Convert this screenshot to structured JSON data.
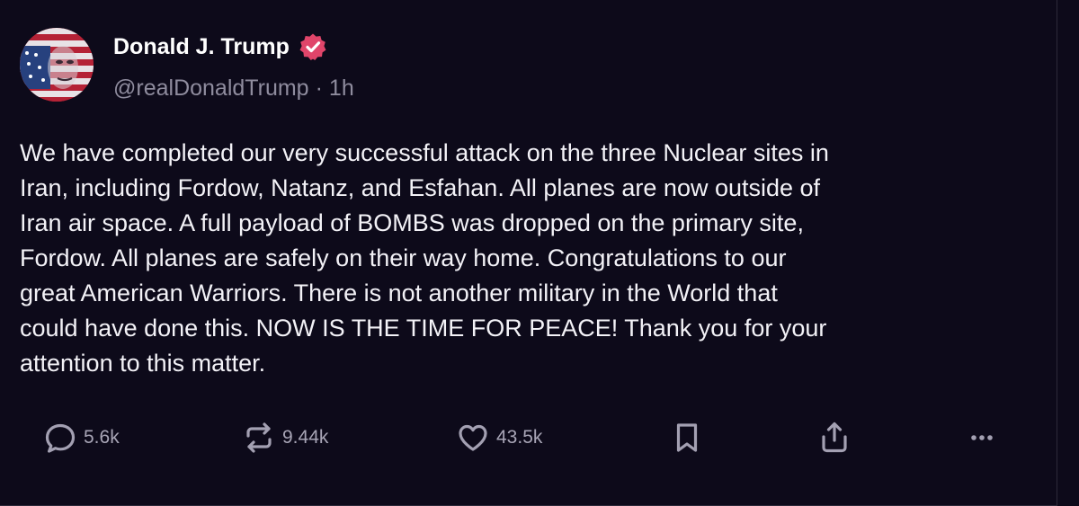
{
  "post": {
    "author": {
      "display_name": "Donald J. Trump",
      "handle": "@realDonaldTrump",
      "separator": "·",
      "time": "1h",
      "verified_badge_color": "#e0456a"
    },
    "body": "We have completed our very successful attack on the three Nuclear sites in\nIran, including Fordow, Natanz, and Esfahan. All planes are now outside of\nIran air space. A full payload of BOMBS was dropped on the primary site,\nFordow. All planes are safely on their way home. Congratulations to our\ngreat American Warriors. There is not another military in the World that\ncould have done this. NOW IS THE TIME FOR PEACE! Thank you for your\nattention to this matter.",
    "actions": {
      "reply_count": "5.6k",
      "repost_count": "9.44k",
      "like_count": "43.5k",
      "icons": [
        "reply-icon",
        "repost-icon",
        "heart-icon",
        "bookmark-icon",
        "share-icon",
        "more-icon"
      ]
    }
  },
  "colors": {
    "background": "#0d0a1a",
    "text": "#f3f2f7",
    "muted": "#8f8c9e",
    "accent": "#e0456a"
  }
}
